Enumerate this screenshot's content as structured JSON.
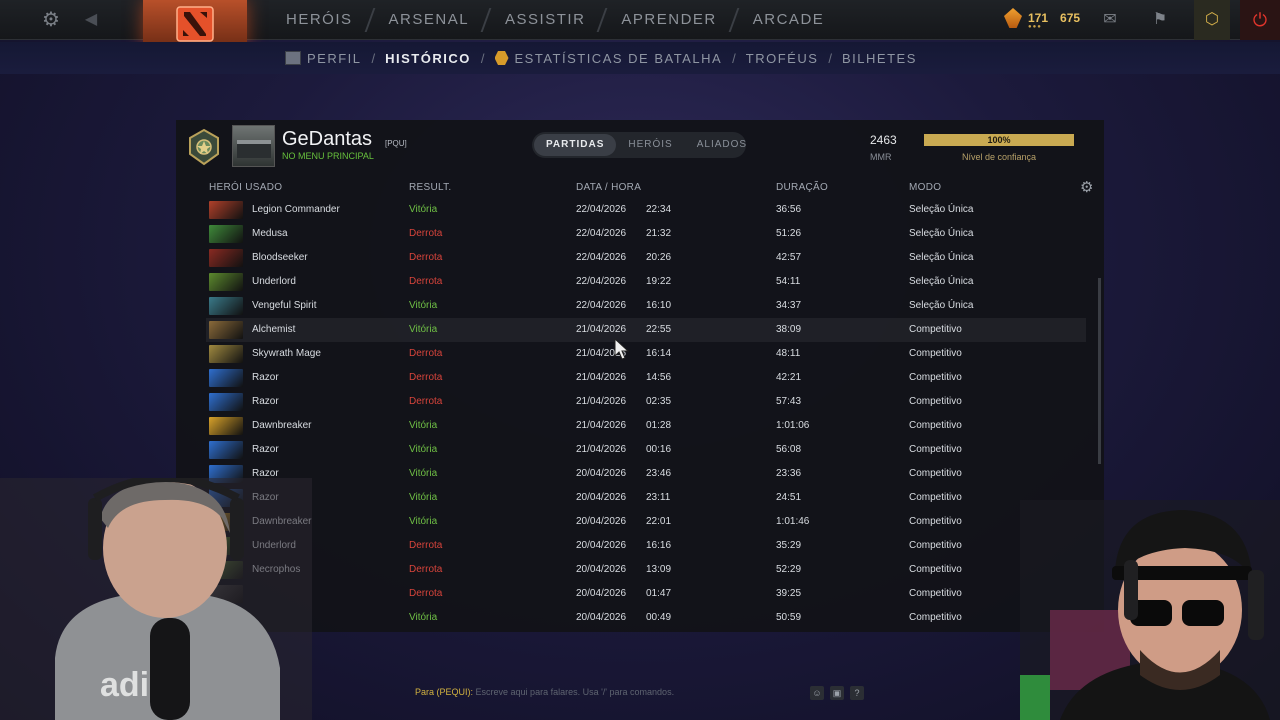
{
  "topnav": {
    "items": [
      "HERÓIS",
      "ARSENAL",
      "ASSISTIR",
      "APRENDER",
      "ARCADE"
    ],
    "shards": "171",
    "currency2": "675",
    "currency_dots": "●●●",
    "icons": [
      "settings-gear-icon",
      "back-arrow-icon",
      "dota-logo-icon",
      "shards-icon",
      "mail-icon",
      "armory-icon",
      "notification-icon",
      "power-icon"
    ]
  },
  "subnav": {
    "items": [
      "PERFIL",
      "HISTÓRICO",
      "ESTATÍSTICAS DE BATALHA",
      "TROFÉUS",
      "BILHETES"
    ],
    "active": "HISTÓRICO"
  },
  "profile": {
    "username": "GeDantas",
    "tag": "[PQU]",
    "status": "NO MENU PRINCIPAL",
    "tabs": [
      "PARTIDAS",
      "HERÓIS",
      "ALIADOS"
    ],
    "active_tab": "PARTIDAS",
    "mmr_value": "2463",
    "mmr_label": "MMR",
    "confidence_value": "100%",
    "confidence_fraction": 1.0,
    "confidence_label": "Nível de confiança"
  },
  "table": {
    "headers": {
      "hero": "HERÓI USADO",
      "result": "RESULT.",
      "datetime": "DATA / HORA",
      "duration": "DURAÇÃO",
      "mode": "MODO"
    },
    "rows": [
      {
        "hero": "Legion Commander",
        "result": "Vitória",
        "win": true,
        "date": "22/04/2026",
        "time": "22:34",
        "duration": "36:56",
        "mode": "Seleção Única",
        "color": "#b0402a"
      },
      {
        "hero": "Medusa",
        "result": "Derrota",
        "win": false,
        "date": "22/04/2026",
        "time": "21:32",
        "duration": "51:26",
        "mode": "Seleção Única",
        "color": "#3f8a3a"
      },
      {
        "hero": "Bloodseeker",
        "result": "Derrota",
        "win": false,
        "date": "22/04/2026",
        "time": "20:26",
        "duration": "42:57",
        "mode": "Seleção Única",
        "color": "#8a2a22"
      },
      {
        "hero": "Underlord",
        "result": "Derrota",
        "win": false,
        "date": "22/04/2026",
        "time": "19:22",
        "duration": "54:11",
        "mode": "Seleção Única",
        "color": "#5c8a2e"
      },
      {
        "hero": "Vengeful Spirit",
        "result": "Vitória",
        "win": true,
        "date": "22/04/2026",
        "time": "16:10",
        "duration": "34:37",
        "mode": "Seleção Única",
        "color": "#3a7a8a"
      },
      {
        "hero": "Alchemist",
        "result": "Vitória",
        "win": true,
        "date": "21/04/2026",
        "time": "22:55",
        "duration": "38:09",
        "mode": "Competitivo",
        "color": "#8a6a3a"
      },
      {
        "hero": "Skywrath Mage",
        "result": "Derrota",
        "win": false,
        "date": "21/04/2026",
        "time": "16:14",
        "duration": "48:11",
        "mode": "Competitivo",
        "color": "#a08a40"
      },
      {
        "hero": "Razor",
        "result": "Derrota",
        "win": false,
        "date": "21/04/2026",
        "time": "14:56",
        "duration": "42:21",
        "mode": "Competitivo",
        "color": "#2f6fcf"
      },
      {
        "hero": "Razor",
        "result": "Derrota",
        "win": false,
        "date": "21/04/2026",
        "time": "02:35",
        "duration": "57:43",
        "mode": "Competitivo",
        "color": "#2f6fcf"
      },
      {
        "hero": "Dawnbreaker",
        "result": "Vitória",
        "win": true,
        "date": "21/04/2026",
        "time": "01:28",
        "duration": "1:01:06",
        "mode": "Competitivo",
        "color": "#d8a22a"
      },
      {
        "hero": "Razor",
        "result": "Vitória",
        "win": true,
        "date": "21/04/2026",
        "time": "00:16",
        "duration": "56:08",
        "mode": "Competitivo",
        "color": "#2f6fcf"
      },
      {
        "hero": "Razor",
        "result": "Vitória",
        "win": true,
        "date": "20/04/2026",
        "time": "23:46",
        "duration": "23:36",
        "mode": "Competitivo",
        "color": "#2f6fcf"
      },
      {
        "hero": "Razor",
        "result": "Vitória",
        "win": true,
        "date": "20/04/2026",
        "time": "23:11",
        "duration": "24:51",
        "mode": "Competitivo",
        "color": "#2f6fcf"
      },
      {
        "hero": "Dawnbreaker",
        "result": "Vitória",
        "win": true,
        "date": "20/04/2026",
        "time": "22:01",
        "duration": "1:01:46",
        "mode": "Competitivo",
        "color": "#d8a22a"
      },
      {
        "hero": "Underlord",
        "result": "Derrota",
        "win": false,
        "date": "20/04/2026",
        "time": "16:16",
        "duration": "35:29",
        "mode": "Competitivo",
        "color": "#5c8a2e"
      },
      {
        "hero": "Necrophos",
        "result": "Derrota",
        "win": false,
        "date": "20/04/2026",
        "time": "13:09",
        "duration": "52:29",
        "mode": "Competitivo",
        "color": "#5a7a3a"
      },
      {
        "hero": "",
        "result": "Derrota",
        "win": false,
        "date": "20/04/2026",
        "time": "01:47",
        "duration": "39:25",
        "mode": "Competitivo",
        "color": "#444"
      },
      {
        "hero": "",
        "result": "Vitória",
        "win": true,
        "date": "20/04/2026",
        "time": "00:49",
        "duration": "50:59",
        "mode": "Competitivo",
        "color": "#444"
      }
    ]
  },
  "chat": {
    "prefix": "Para (PEQUI):",
    "placeholder": "Escreve aqui para falares. Usa '/' para comandos."
  }
}
